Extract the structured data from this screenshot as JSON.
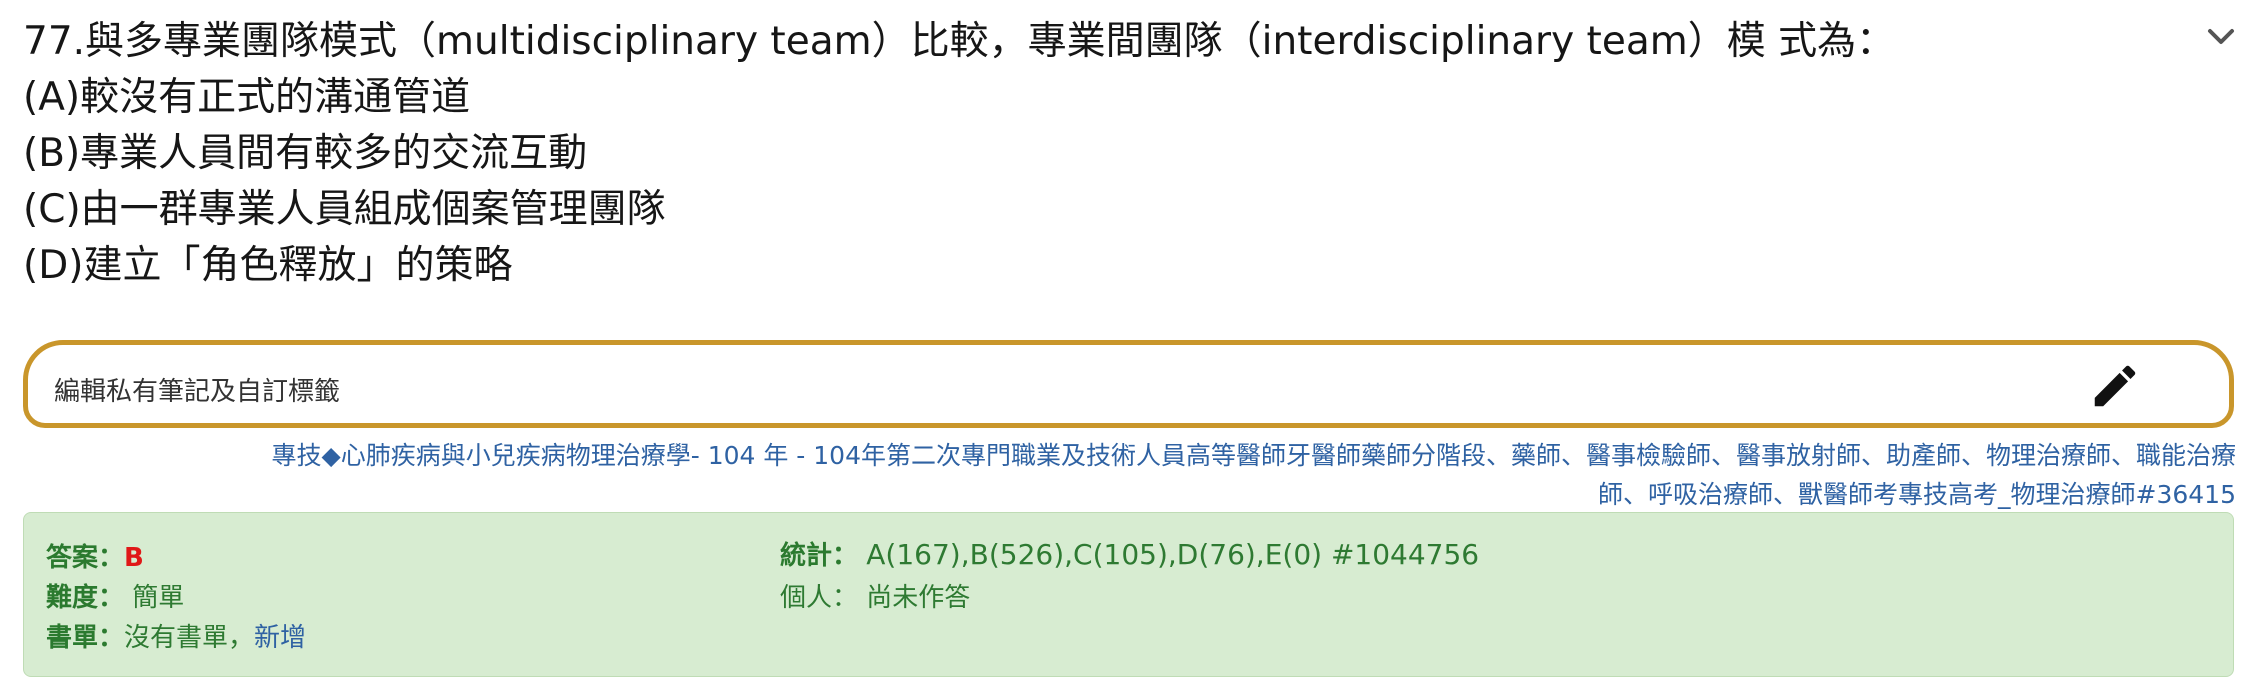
{
  "question": {
    "stem": "77.與多專業團隊模式（multidisciplinary team）比較，專業間團隊（interdisciplinary team）模 式為：",
    "options": [
      "(A)較沒有正式的溝通管道",
      "(B)專業人員間有較多的交流互動",
      "(C)由一群專業人員組成個案管理團隊",
      "(D)建立「角色釋放」的策略"
    ]
  },
  "note": {
    "label": "編輯私有筆記及自訂標籤"
  },
  "source": {
    "line1": "專技◆心肺疾病與小兒疾病物理治療學- 104 年 - 104年第二次專門職業及技術人員高等醫師牙醫師藥師分階段、藥師、醫事檢驗師、醫事放射師、助產師、物理治療師、職能治療",
    "line2": "師、呼吸治療師、獸醫師考專技高考_物理治療師#36415"
  },
  "answer_panel": {
    "answer_label": "答案：",
    "answer_value": "B",
    "difficulty_label": "難度：",
    "difficulty_value": "簡單",
    "booklist_label": "書單：",
    "booklist_value": "沒有書單，",
    "booklist_add": "新增",
    "stats_label": "統計：",
    "stats_value": "A(167),B(526),C(105),D(76),E(0) #1044756",
    "personal_label": "個人：",
    "personal_value": "尚未作答"
  },
  "colors": {
    "note_border": "#c9962b",
    "panel_bg": "#d7ecd1",
    "answer_red": "#e01818",
    "link_blue": "#2f62a3",
    "label_green": "#2b7a2f"
  },
  "icons": {
    "collapse": "chevron-down-icon",
    "edit": "pencil-icon"
  }
}
